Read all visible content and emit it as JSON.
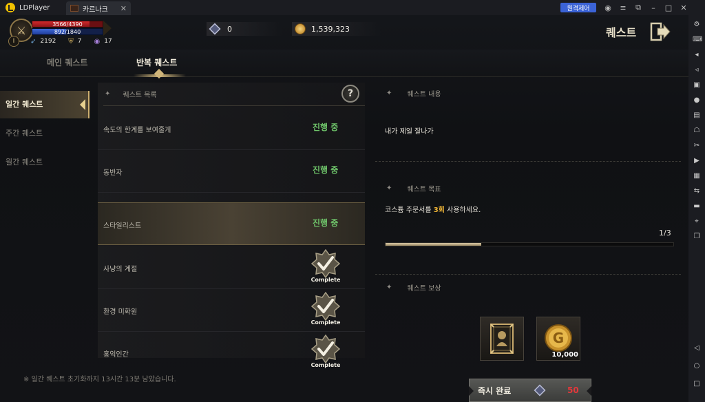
{
  "emulator": {
    "app_name": "LDPlayer",
    "tab_label": "카르나크",
    "remote_button": "원격제어"
  },
  "hud": {
    "hp": "3566/4390",
    "hp_fraction": 0.81,
    "mp": "892/1840",
    "mp_fraction": 0.48,
    "level_icon": "I",
    "stat1": "2192",
    "stat2": "7",
    "stat3": "17",
    "gems": "0",
    "gold": "1,539,323",
    "title": "퀘스트"
  },
  "tabs": {
    "main": "메인 퀘스트",
    "repeat": "반복 퀘스트"
  },
  "categories": [
    {
      "label": "일간 퀘스트",
      "active": true
    },
    {
      "label": "주간 퀘스트",
      "active": false
    },
    {
      "label": "월간 퀘스트",
      "active": false
    }
  ],
  "quest_list": {
    "header": "퀘스트 목록",
    "help": "?",
    "items": [
      {
        "name": "속도의 한계를 보여줄게",
        "status": "진행 중"
      },
      {
        "name": "동반자",
        "status": "진행 중"
      },
      {
        "name": "스타일리스트",
        "status": "진행 중"
      },
      {
        "name": "사냥의 계절",
        "status": "Complete"
      },
      {
        "name": "환경 미화원",
        "status": "Complete"
      },
      {
        "name": "홍익인간",
        "status": "Complete"
      }
    ]
  },
  "footer_note": "※ 일간 퀘스트 초기화까지 13시간 13분 남았습니다.",
  "detail": {
    "content_header": "퀘스트 내용",
    "content_text": "내가 제일 잘나가",
    "goal_header": "퀘스트 목표",
    "goal_pre": "코스튬 주문서를 ",
    "goal_count": "3회",
    "goal_post": " 사용하세요.",
    "progress": "1/3",
    "progress_fraction": 0.333,
    "reward_header": "퀘스트 보상",
    "reward_gold_qty": "10,000",
    "instant_label": "즉시 완료",
    "instant_cost": "50"
  }
}
